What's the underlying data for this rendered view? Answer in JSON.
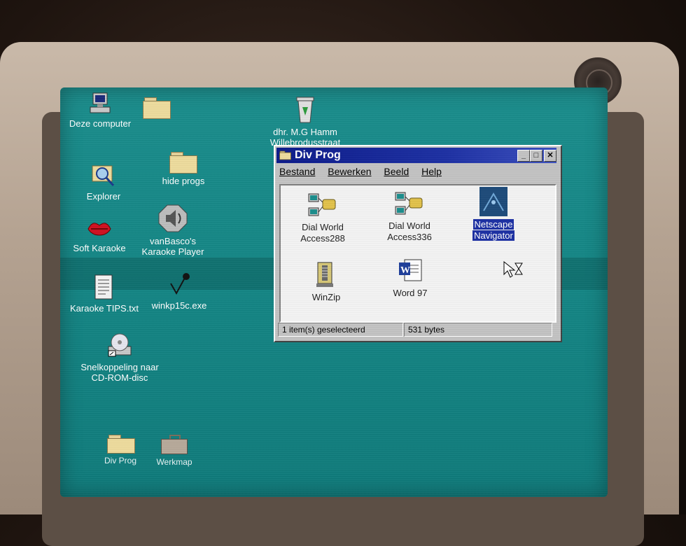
{
  "desktop": {
    "icons": [
      {
        "name": "my-computer",
        "label": "Deze computer"
      },
      {
        "name": "unnamed-folder",
        "label": ""
      },
      {
        "name": "recycle-bin",
        "label": "dhr. M.G Hamm\nWillebrodusstraat"
      },
      {
        "name": "hide-progs-folder",
        "label": "hide progs"
      },
      {
        "name": "explorer",
        "label": "Explorer"
      },
      {
        "name": "soft-karaoke",
        "label": "Soft Karaoke"
      },
      {
        "name": "vanbasco",
        "label": "vanBasco's\nKaraoke Player"
      },
      {
        "name": "karaoke-tips",
        "label": "Karaoke TIPS.txt"
      },
      {
        "name": "winkp15c",
        "label": "winkp15c.exe"
      },
      {
        "name": "cdrom-shortcut",
        "label": "Snelkoppeling naar\nCD-ROM-disc"
      },
      {
        "name": "div-prog-folder",
        "label": "Div Prog"
      },
      {
        "name": "werkmap",
        "label": "Werkmap"
      }
    ]
  },
  "window": {
    "title": "Div Prog",
    "buttons": {
      "minimize": "_",
      "maximize": "□",
      "close": "✕"
    },
    "menu": [
      "Bestand",
      "Bewerken",
      "Beeld",
      "Help"
    ],
    "items": [
      {
        "label_line1": "Dial World",
        "label_line2": "Access288",
        "icon": "dial-up-icon",
        "selected": false
      },
      {
        "label_line1": "Dial World",
        "label_line2": "Access336",
        "icon": "dial-up-icon",
        "selected": false
      },
      {
        "label_line1": "Netscape",
        "label_line2": "Navigator",
        "icon": "netscape-icon",
        "selected": true
      },
      {
        "label_line1": "WinZip",
        "label_line2": "",
        "icon": "winzip-icon",
        "selected": false
      },
      {
        "label_line1": "Word 97",
        "label_line2": "",
        "icon": "word-icon",
        "selected": false
      }
    ],
    "status": {
      "selected": "1 item(s) geselecteerd",
      "size": "531 bytes"
    }
  },
  "colors": {
    "desktop": "#148685",
    "titlebar": "#0b1a8a",
    "window_face": "#c3c3c3",
    "selection": "#1c2fa3"
  }
}
